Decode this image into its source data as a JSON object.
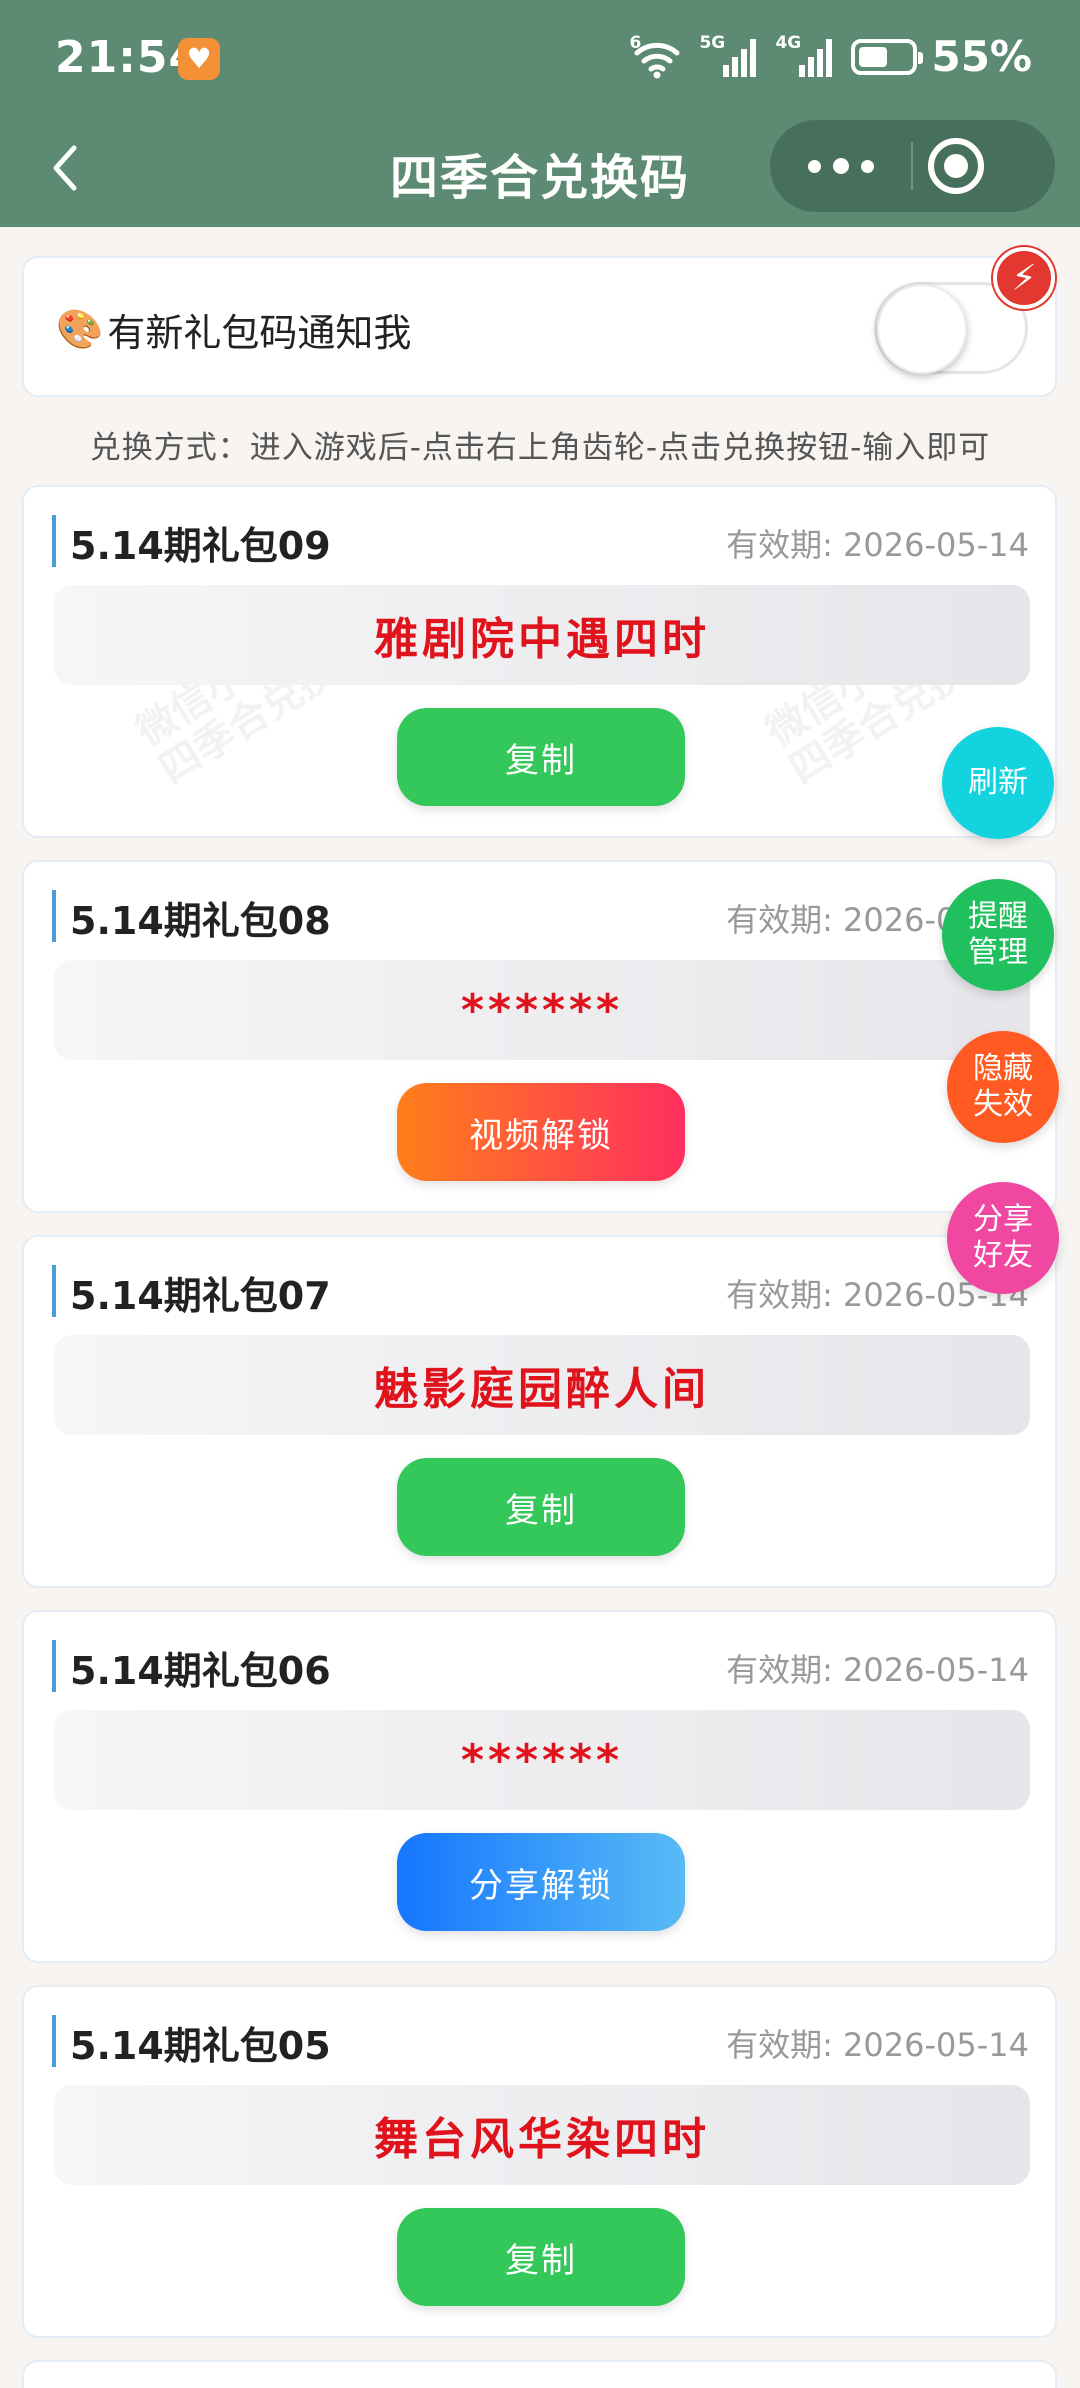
{
  "status_bar": {
    "time": "21:54",
    "signal_1": "5G",
    "signal_2": "4G",
    "wifi_tag": "6",
    "battery": "55%",
    "battery_level": 0.55
  },
  "nav": {
    "title": "四季合兑换码"
  },
  "notify": {
    "label": "有新礼包码通知我",
    "toggle_on": false
  },
  "instructions": "兑换方式：进入游戏后-点击右上角齿轮-点击兑换按钮-输入即可",
  "gifts": [
    {
      "title": "5.14期礼包09",
      "expiry": "有效期: 2026-05-14",
      "code": "雅剧院中遇四时",
      "action": "复制"
    },
    {
      "title": "5.14期礼包08",
      "expiry": "有效期: 2026-05-14",
      "code": "******",
      "action": "视频解锁"
    },
    {
      "title": "5.14期礼包07",
      "expiry": "有效期: 2026-05-14",
      "code": "魅影庭园醉人间",
      "action": "复制"
    },
    {
      "title": "5.14期礼包06",
      "expiry": "有效期: 2026-05-14",
      "code": "******",
      "action": "分享解锁"
    },
    {
      "title": "5.14期礼包05",
      "expiry": "有效期: 2026-05-14",
      "code": "舞台风华染四时",
      "action": "复制"
    }
  ],
  "floating": {
    "refresh": "刷新",
    "reminder": "提醒\n管理",
    "hide_expired": "隐藏\n失效",
    "share_friends": "分享\n好友"
  },
  "colors": {
    "header": "#5c8a72",
    "copy_button": "#34c759",
    "code_text": "#e0121b",
    "refresh": "#13d4de",
    "reminder": "#20c05e",
    "hide_expired": "#ff5a22",
    "share_friends": "#f048a0"
  }
}
